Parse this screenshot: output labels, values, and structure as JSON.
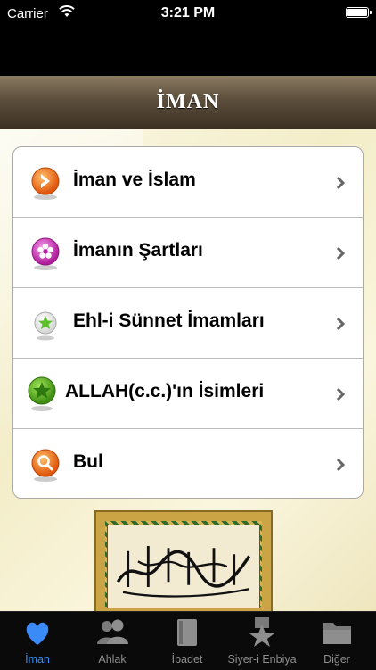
{
  "status_bar": {
    "carrier": "Carrier",
    "time": "3:21 PM"
  },
  "nav": {
    "title": "İMAN"
  },
  "menu": {
    "items": [
      {
        "label": "İman ve İslam",
        "icon": "orange-arrow-icon"
      },
      {
        "label": "İmanın Şartları",
        "icon": "pink-flower-icon"
      },
      {
        "label": "Ehl-i Sünnet İmamları",
        "icon": "green-star-icon"
      },
      {
        "label": "ALLAH(c.c.)'ın İsimleri",
        "icon": "green-star-badge-icon"
      },
      {
        "label": "Bul",
        "icon": "search-icon"
      }
    ]
  },
  "tabs": [
    {
      "label": "İman",
      "icon": "heart-icon",
      "active": true
    },
    {
      "label": "Ahlak",
      "icon": "people-icon",
      "active": false
    },
    {
      "label": "İbadet",
      "icon": "book-icon",
      "active": false
    },
    {
      "label": "Siyer-i Enbiya",
      "icon": "star-medal-icon",
      "active": false
    },
    {
      "label": "Diğer",
      "icon": "folder-icon",
      "active": false
    }
  ],
  "colors": {
    "tab_active": "#3a8bf7",
    "tab_inactive": "#8e8e8e"
  }
}
